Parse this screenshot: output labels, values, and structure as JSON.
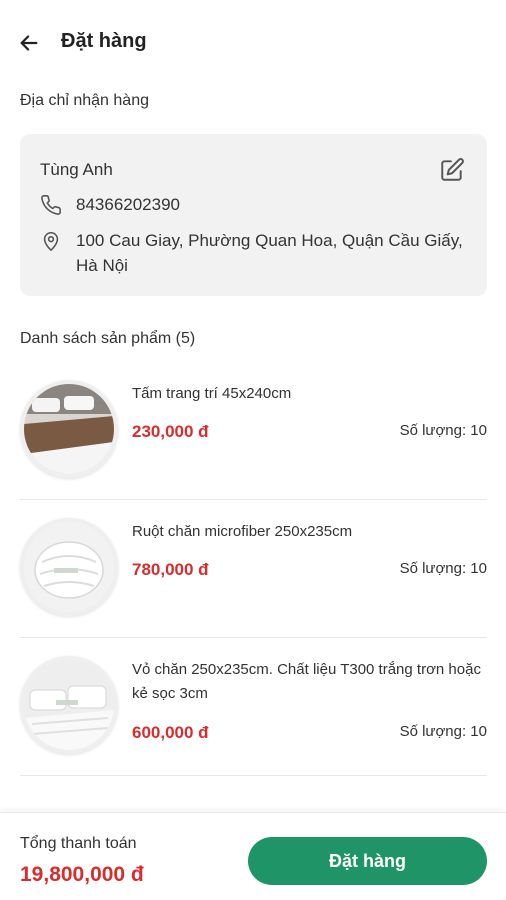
{
  "header": {
    "title": "Đặt hàng",
    "back_icon": "arrow-left-icon"
  },
  "address": {
    "section_label": "Địa chỉ nhận hàng",
    "name": "Tùng Anh",
    "phone": "84366202390",
    "location": "100 Cau Giay, Phường Quan Hoa, Quận Cầu Giấy, Hà Nội",
    "edit_icon": "edit-icon"
  },
  "products": {
    "section_label": "Danh sách sản phẩm (5)",
    "items": [
      {
        "name": "Tấm trang trí 45x240cm",
        "price": "230,000 đ",
        "quantity": "Số lượng: 10"
      },
      {
        "name": "Ruột chăn microfiber 250x235cm",
        "price": "780,000 đ",
        "quantity": "Số lượng: 10"
      },
      {
        "name": "Vỏ chăn 250x235cm. Chất liệu T300 trắng trơn hoặc kẻ sọc 3cm",
        "price": "600,000 đ",
        "quantity": "Số lượng: 10"
      }
    ]
  },
  "footer": {
    "total_label": "Tổng thanh toán",
    "total_value": "19,800,000 đ",
    "order_button": "Đặt hàng"
  },
  "colors": {
    "accent": "#1f9466",
    "price": "#d92c2c",
    "card_bg": "#f2f2f2"
  }
}
